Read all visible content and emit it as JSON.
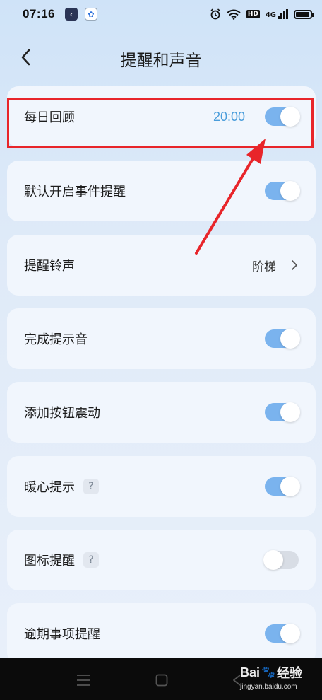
{
  "status_bar": {
    "time": "07:16",
    "hd": "HD",
    "network": "4G"
  },
  "header": {
    "title": "提醒和声音"
  },
  "rows": [
    {
      "label": "每日回顾",
      "value": "20:00",
      "toggle": "on"
    },
    {
      "label": "默认开启事件提醒",
      "toggle": "on"
    },
    {
      "label": "提醒铃声",
      "value": "阶梯"
    },
    {
      "label": "完成提示音",
      "toggle": "on"
    },
    {
      "label": "添加按钮震动",
      "toggle": "on"
    },
    {
      "label": "暖心提示",
      "help": "?",
      "toggle": "on"
    },
    {
      "label": "图标提醒",
      "help": "?",
      "toggle": "off"
    },
    {
      "label": "逾期事项提醒",
      "toggle": "on"
    }
  ],
  "watermark": {
    "logo": "Bai🐾经验",
    "logo_a": "Bai",
    "logo_b": "经验",
    "url": "jingyan.baidu.com"
  },
  "colors": {
    "accent": "#7ab3ee",
    "time_value": "#4a9ddb",
    "annotation": "#e8252a"
  }
}
